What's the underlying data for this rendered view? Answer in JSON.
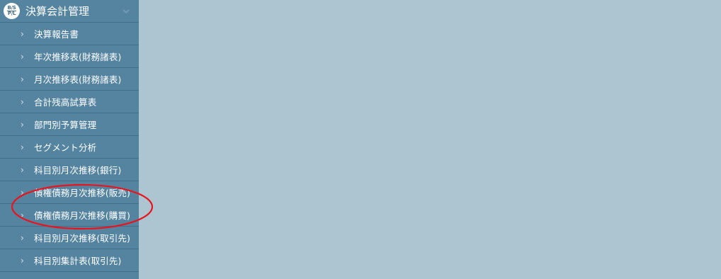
{
  "sidebar": {
    "header": {
      "icon_text_top": "B/S",
      "icon_text_bottom": "P/L",
      "title": "決算会計管理",
      "icon": "chevron-down-icon"
    },
    "items": [
      {
        "label": "決算報告書",
        "icon": "chevron-right-icon"
      },
      {
        "label": "年次推移表(財務諸表)",
        "icon": "chevron-right-icon"
      },
      {
        "label": "月次推移表(財務諸表)",
        "icon": "chevron-right-icon"
      },
      {
        "label": "合計残高試算表",
        "icon": "chevron-right-icon"
      },
      {
        "label": "部門別予算管理",
        "icon": "chevron-right-icon"
      },
      {
        "label": "セグメント分析",
        "icon": "chevron-right-icon"
      },
      {
        "label": "科目別月次推移(銀行)",
        "icon": "chevron-right-icon"
      },
      {
        "label": "債権債務月次推移(販売)",
        "icon": "chevron-right-icon"
      },
      {
        "label": "債権債務月次推移(購買)",
        "icon": "chevron-right-icon"
      },
      {
        "label": "科目別月次推移(取引先)",
        "icon": "chevron-right-icon"
      },
      {
        "label": "科目別集計表(取引先)",
        "icon": "chevron-right-icon"
      }
    ]
  },
  "colors": {
    "sidebar_bg": "#5484a0",
    "content_bg": "#adc5d1",
    "annotation_ellipse": "#e8141e"
  }
}
